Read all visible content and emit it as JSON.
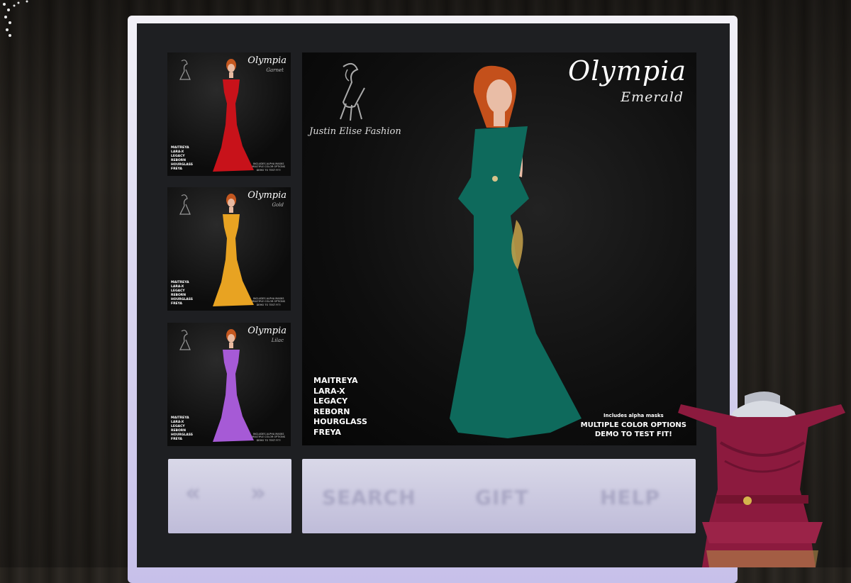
{
  "gallery": [
    {
      "title": "Olympia",
      "subtitle": "Garnet",
      "color": "#c8121a",
      "bodies": [
        "MAITREYA",
        "LARA-X",
        "LEGACY",
        "REBORN",
        "HOURGLASS",
        "FREYA"
      ],
      "notes": [
        "INCLUDES ALPHA MASKS",
        "MULTIPLE COLOR OPTIONS",
        "DEMO TO TEST FIT!"
      ]
    },
    {
      "title": "Olympia",
      "subtitle": "Gold",
      "color": "#e8a322",
      "bodies": [
        "MAITREYA",
        "LARA-X",
        "LEGACY",
        "REBORN",
        "HOURGLASS",
        "FREYA"
      ],
      "notes": [
        "INCLUDES ALPHA MASKS",
        "MULTIPLE COLOR OPTIONS",
        "DEMO TO TEST FIT!"
      ]
    },
    {
      "title": "Olympia",
      "subtitle": "Lilac",
      "color": "#a65ad6",
      "bodies": [
        "MAITREYA",
        "LARA-X",
        "LEGACY",
        "REBORN",
        "HOURGLASS",
        "FREYA"
      ],
      "notes": [
        "INCLUDES ALPHA MASKS",
        "MULTIPLE COLOR OPTIONS",
        "DEMO TO TEST FIT!"
      ]
    }
  ],
  "main": {
    "title": "Olympia",
    "subtitle": "Emerald",
    "brand": "Justin Elise Fashion",
    "color": "#0e6a5c",
    "bodies": [
      "MAITREYA",
      "LARA-X",
      "LEGACY",
      "REBORN",
      "HOURGLASS",
      "FREYA"
    ],
    "notes_small": "Includes alpha masks",
    "notes_big": [
      "MULTIPLE COLOR OPTIONS",
      "DEMO TO TEST FIT!"
    ]
  },
  "nav": {
    "prev": "«",
    "next": "»"
  },
  "actions": {
    "search": "SEARCH",
    "gift": "GIFT",
    "help": "HELP"
  },
  "colors": {
    "frame_accent": "#c7c0ea",
    "button_text": "#a9a7c4",
    "mannequin_dress": "#8c1a3e"
  }
}
